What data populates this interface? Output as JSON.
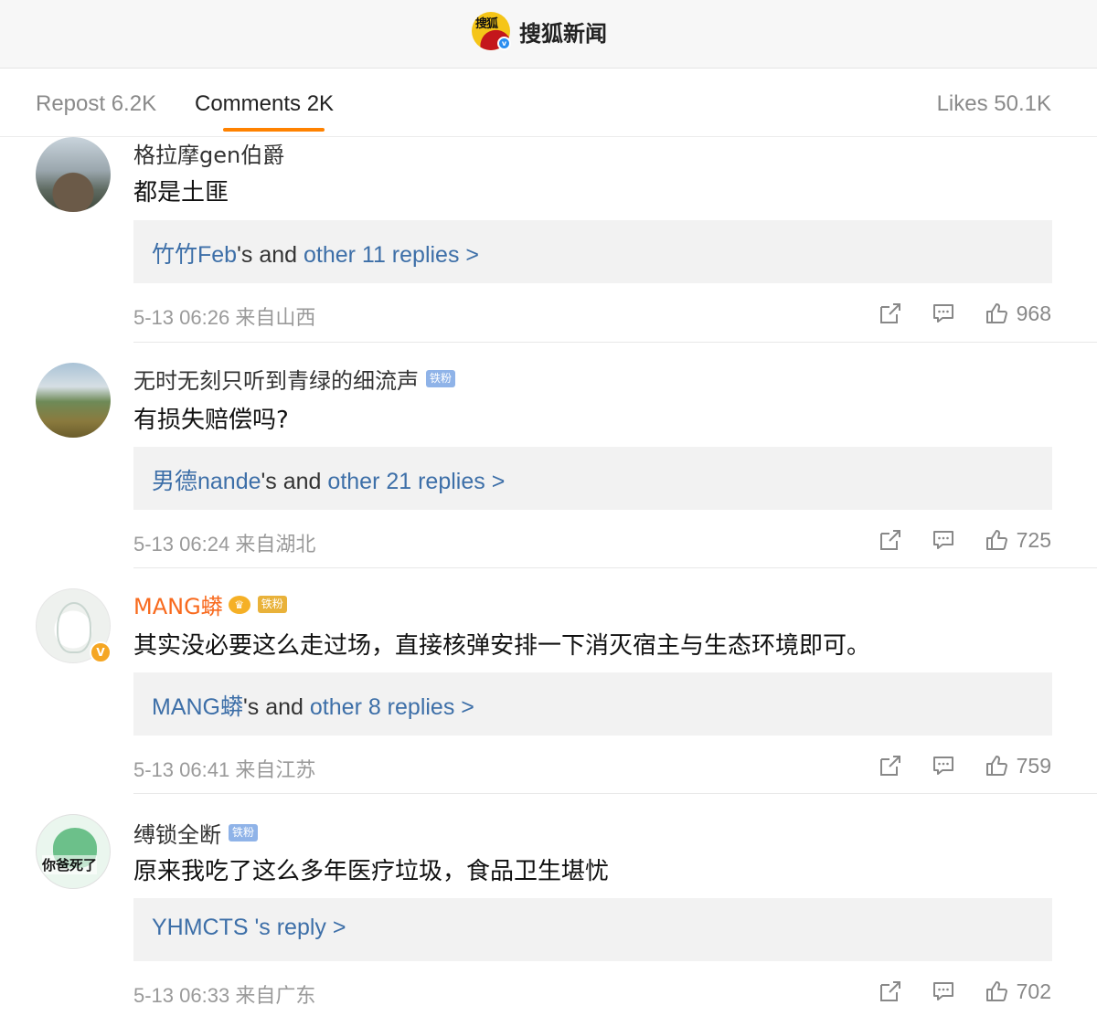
{
  "header": {
    "app_name": "搜狐新闻",
    "logo_text": "搜狐",
    "verified_mark": "v"
  },
  "tabs": {
    "repost": "Repost 6.2K",
    "comments": "Comments 2K",
    "likes": "Likes 50.1K",
    "active": "comments",
    "accent_color": "#ff8200"
  },
  "colors": {
    "link_blue": "#3d6fa8",
    "vip_orange": "#f86a1e",
    "fan_badge": "#8fb3e8",
    "reply_bg": "#f2f2f2"
  },
  "icons": [
    "share-icon",
    "comment-icon",
    "thumbs-up-icon",
    "crown-icon",
    "verified-icon"
  ],
  "comments": [
    {
      "username": "格拉摩gen伯爵",
      "text": "都是土匪",
      "reply_user": "竹竹Feb",
      "reply_middle": "'s and ",
      "reply_more": "other 11 replies >",
      "timestamp": "5-13 06:26",
      "location": "来自山西",
      "likes": "968"
    },
    {
      "username": "无时无刻只听到青绿的细流声",
      "badge": "铁粉",
      "text": "有损失赔偿吗?",
      "reply_user": "男德nande",
      "reply_middle": "'s and ",
      "reply_more": "other 21 replies >",
      "timestamp": "5-13 06:24",
      "location": "来自湖北",
      "likes": "725"
    },
    {
      "username": "MANG蟒",
      "badge": "铁粉",
      "text": "其实没必要这么走过场，直接核弹安排一下消灭宿主与生态环境即可。",
      "reply_user": "MANG蟒",
      "reply_middle": "'s and ",
      "reply_more": "other 8 replies >",
      "timestamp": "5-13 06:41",
      "location": "来自江苏",
      "likes": "759"
    },
    {
      "username": "缚锁全断",
      "badge": "铁粉",
      "avatar_text": "你爸死了",
      "text": "原来我吃了这么多年医疗垃圾，食品卫生堪忧",
      "reply_user": "YHMCTS",
      "reply_middle": " 's reply >",
      "timestamp": "5-13 06:33",
      "location": "来自广东",
      "likes": "702"
    }
  ]
}
